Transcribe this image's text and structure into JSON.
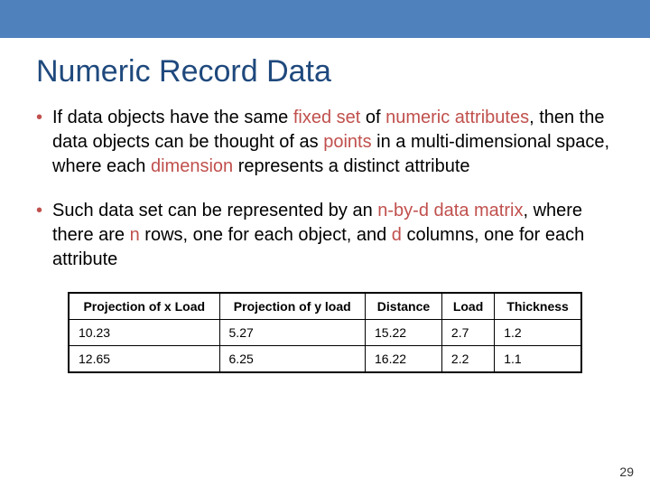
{
  "title": "Numeric Record Data",
  "bullets": {
    "b1": {
      "t1": "If data objects have the same ",
      "t2": "fixed set",
      "t3": " of ",
      "t4": "numeric attributes",
      "t5": ", then the data objects can be thought of as ",
      "t6": "points",
      "t7": " in a multi-dimensional space, where each ",
      "t8": "dimension",
      "t9": " represents a distinct attribute"
    },
    "b2": {
      "t1": "Such data set can be represented by an ",
      "t2": "n-by-d",
      "t3": " ",
      "t4": "data matrix",
      "t5": ", where there are ",
      "t6": "n",
      "t7": " rows, one for each object, and ",
      "t8": "d",
      "t9": " columns, one for each attribute"
    }
  },
  "chart_data": {
    "type": "table",
    "headers": [
      "Projection of x Load",
      "Projection of y load",
      "Distance",
      "Load",
      "Thickness"
    ],
    "rows": [
      [
        "10.23",
        "5.27",
        "15.22",
        "2.7",
        "1.2"
      ],
      [
        "12.65",
        "6.25",
        "16.22",
        "2.2",
        "1.1"
      ]
    ]
  },
  "page_number": "29"
}
